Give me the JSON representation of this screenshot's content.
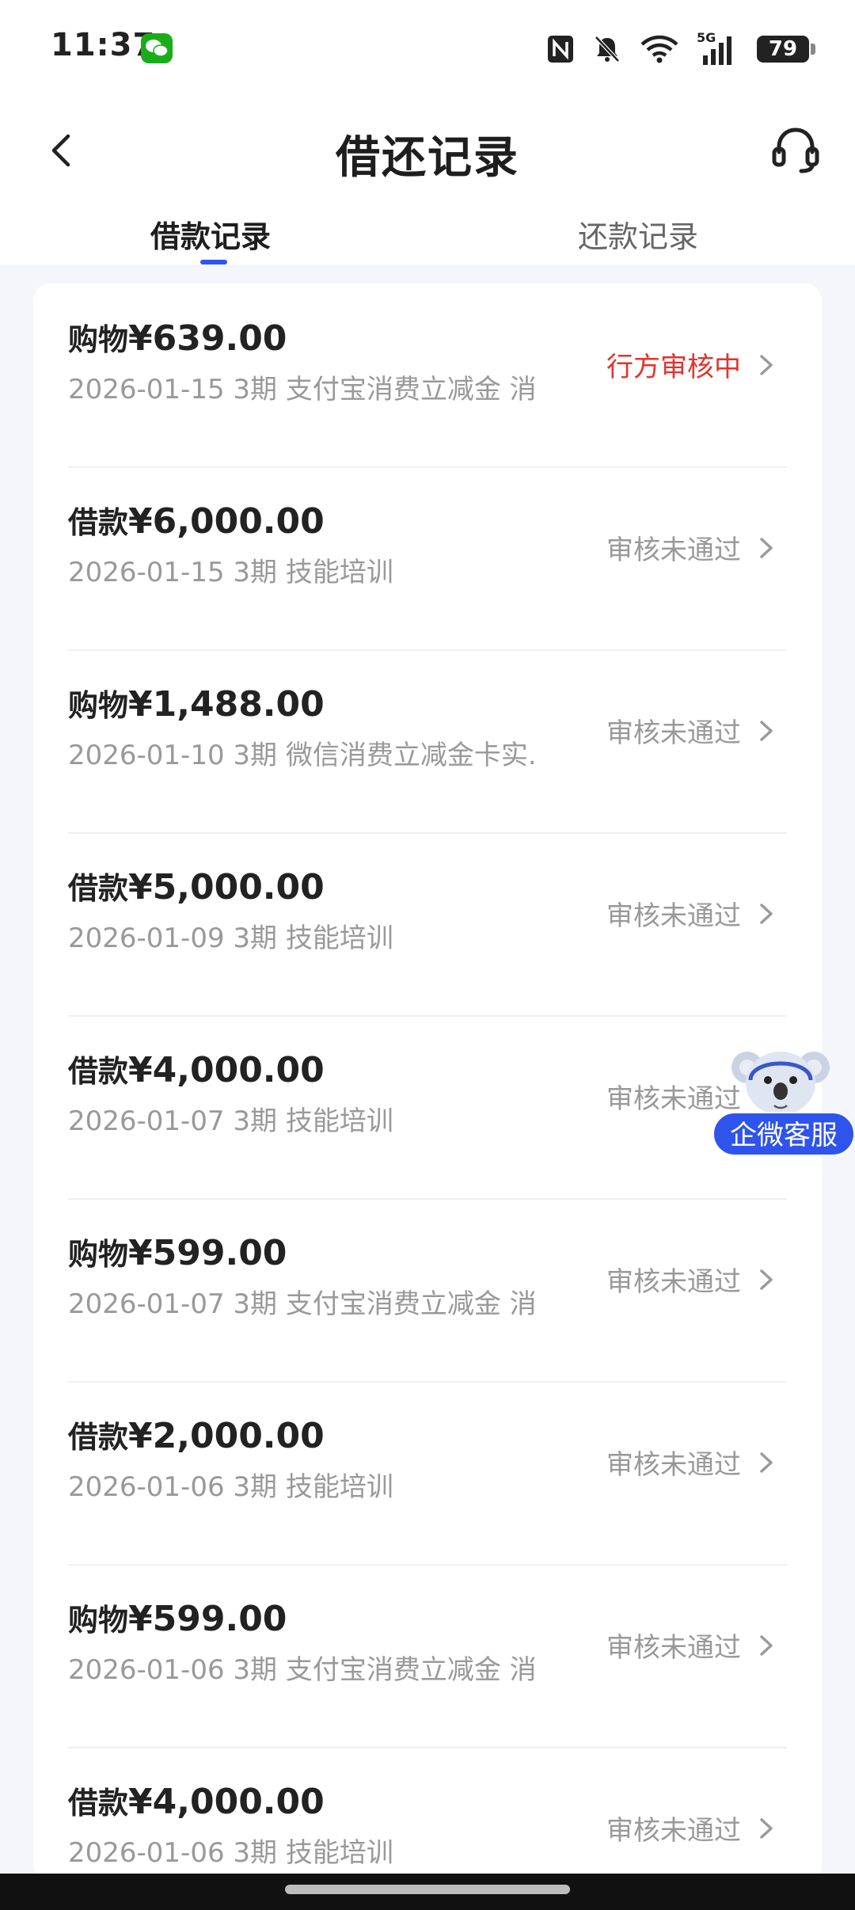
{
  "status_bar": {
    "time": "11:37",
    "battery": "79",
    "network": "5G"
  },
  "header": {
    "title": "借还记录"
  },
  "tabs": [
    {
      "label": "借款记录",
      "active": true
    },
    {
      "label": "还款记录",
      "active": false
    }
  ],
  "records": [
    {
      "type": "购物",
      "amount": "¥639.00",
      "meta": "2026-01-15 3期  支付宝消费立减金 消...",
      "status": "行方审核中",
      "status_kind": "reviewing"
    },
    {
      "type": "借款",
      "amount": "¥6,000.00",
      "meta": "2026-01-15 3期  技能培训",
      "status": "审核未通过",
      "status_kind": "rejected"
    },
    {
      "type": "购物",
      "amount": "¥1,488.00",
      "meta": "2026-01-10 3期  微信消费立减金卡实...",
      "status": "审核未通过",
      "status_kind": "rejected"
    },
    {
      "type": "借款",
      "amount": "¥5,000.00",
      "meta": "2026-01-09 3期  技能培训",
      "status": "审核未通过",
      "status_kind": "rejected"
    },
    {
      "type": "借款",
      "amount": "¥4,000.00",
      "meta": "2026-01-07 3期  技能培训",
      "status": "审核未通过",
      "status_kind": "rejected"
    },
    {
      "type": "购物",
      "amount": "¥599.00",
      "meta": "2026-01-07 3期  支付宝消费立减金 消...",
      "status": "审核未通过",
      "status_kind": "rejected"
    },
    {
      "type": "借款",
      "amount": "¥2,000.00",
      "meta": "2026-01-06 3期  技能培训",
      "status": "审核未通过",
      "status_kind": "rejected"
    },
    {
      "type": "购物",
      "amount": "¥599.00",
      "meta": "2026-01-06 3期  支付宝消费立减金 消...",
      "status": "审核未通过",
      "status_kind": "rejected"
    },
    {
      "type": "借款",
      "amount": "¥4,000.00",
      "meta": "2026-01-06 3期  技能培训",
      "status": "审核未通过",
      "status_kind": "rejected"
    }
  ],
  "floating_service": {
    "label": "企微客服"
  },
  "colors": {
    "accent": "#2f54eb",
    "reviewing": "#e3332d",
    "muted": "#999999"
  }
}
